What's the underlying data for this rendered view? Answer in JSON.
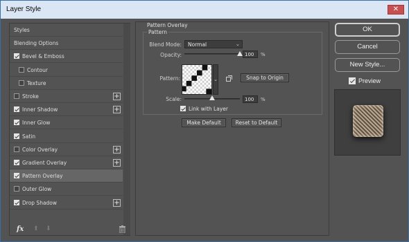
{
  "window": {
    "title": "Layer Style",
    "close_icon": "close-icon"
  },
  "styles_panel": {
    "items": [
      {
        "label": "Styles",
        "checkbox": false,
        "checked": false,
        "indent": false,
        "plus": false,
        "active": false
      },
      {
        "label": "Blending Options",
        "checkbox": false,
        "checked": false,
        "indent": false,
        "plus": false,
        "active": false
      },
      {
        "label": "Bevel & Emboss",
        "checkbox": true,
        "checked": true,
        "indent": false,
        "plus": false,
        "active": false
      },
      {
        "label": "Contour",
        "checkbox": true,
        "checked": false,
        "indent": true,
        "plus": false,
        "active": false
      },
      {
        "label": "Texture",
        "checkbox": true,
        "checked": false,
        "indent": true,
        "plus": false,
        "active": false
      },
      {
        "label": "Stroke",
        "checkbox": true,
        "checked": false,
        "indent": false,
        "plus": true,
        "active": false
      },
      {
        "label": "Inner Shadow",
        "checkbox": true,
        "checked": true,
        "indent": false,
        "plus": true,
        "active": false
      },
      {
        "label": "Inner Glow",
        "checkbox": true,
        "checked": true,
        "indent": false,
        "plus": false,
        "active": false
      },
      {
        "label": "Satin",
        "checkbox": true,
        "checked": true,
        "indent": false,
        "plus": false,
        "active": false
      },
      {
        "label": "Color Overlay",
        "checkbox": true,
        "checked": false,
        "indent": false,
        "plus": true,
        "active": false
      },
      {
        "label": "Gradient Overlay",
        "checkbox": true,
        "checked": true,
        "indent": false,
        "plus": true,
        "active": false
      },
      {
        "label": "Pattern Overlay",
        "checkbox": true,
        "checked": true,
        "indent": false,
        "plus": false,
        "active": true
      },
      {
        "label": "Outer Glow",
        "checkbox": true,
        "checked": false,
        "indent": false,
        "plus": false,
        "active": false
      },
      {
        "label": "Drop Shadow",
        "checkbox": true,
        "checked": true,
        "indent": false,
        "plus": true,
        "active": false
      }
    ],
    "fx_label": "fx"
  },
  "settings": {
    "group_title": "Pattern Overlay",
    "sub_title": "Pattern",
    "blend_mode_label": "Blend Mode:",
    "blend_mode_value": "Normal",
    "opacity_label": "Opacity:",
    "opacity_value": "100",
    "opacity_fraction": 1.0,
    "percent": "%",
    "pattern_label": "Pattern:",
    "snap_button": "Snap to Origin",
    "scale_label": "Scale:",
    "scale_value": "100",
    "link_label": "Link with Layer",
    "link_checked": true,
    "make_default": "Make Default",
    "reset_default": "Reset to Default"
  },
  "right_panel": {
    "ok": "OK",
    "cancel": "Cancel",
    "new_style": "New Style...",
    "preview_label": "Preview",
    "preview_checked": true
  }
}
